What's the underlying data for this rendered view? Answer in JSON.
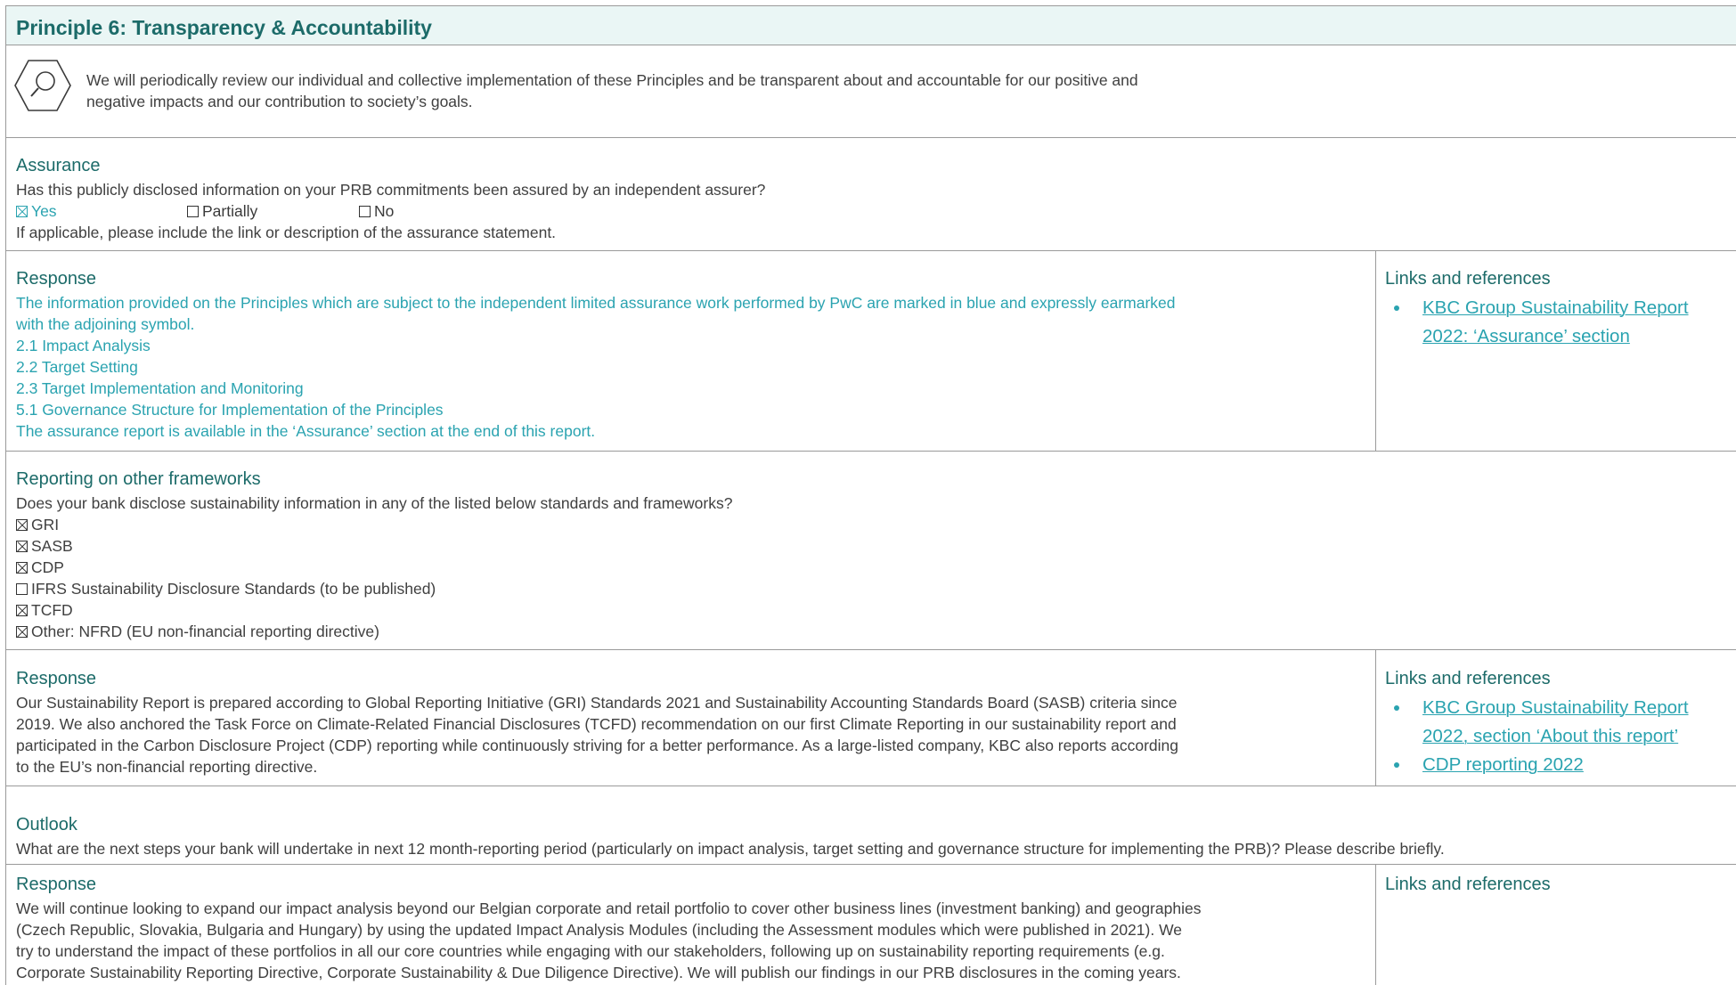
{
  "title": "Principle 6: Transparency & Accountability",
  "intro": {
    "icon": "magnifier-hexagon-icon",
    "lines": [
      "We will periodically review our individual and collective implementation of these Principles and be transparent about and accountable for our positive and",
      "negative impacts and our contribution to society’s goals."
    ]
  },
  "assurance": {
    "heading": "Assurance",
    "question": "Has this publicly disclosed information on your PRB commitments been assured by an independent assurer?",
    "options": [
      {
        "label": "Yes",
        "checked": true
      },
      {
        "label": "Partially",
        "checked": false
      },
      {
        "label": "No",
        "checked": false
      }
    ],
    "note": "If applicable, please include the link or description of the assurance statement."
  },
  "response1": {
    "heading": "Response",
    "lines": [
      "The information provided on the Principles which are subject to the independent limited assurance work performed by PwC are marked in blue and expressly earmarked",
      "with the adjoining symbol.",
      "2.1 Impact Analysis",
      "2.2 Target Setting",
      "2.3 Target Implementation and Monitoring",
      "5.1 Governance Structure for Implementation of the Principles",
      "The assurance report is available in the ‘Assurance’ section at the end of this report."
    ],
    "links_heading": "Links and references",
    "links": [
      {
        "lines": [
          "KBC Group Sustainability Report",
          "2022: ‘Assurance’ section"
        ]
      }
    ]
  },
  "frameworks": {
    "heading": "Reporting on other frameworks",
    "question": "Does your bank disclose sustainability information in any of the listed below standards and frameworks?",
    "items": [
      {
        "label": "GRI",
        "checked": true
      },
      {
        "label": "SASB",
        "checked": true
      },
      {
        "label": "CDP",
        "checked": true
      },
      {
        "label": "IFRS Sustainability Disclosure Standards (to be published)",
        "checked": false
      },
      {
        "label": "TCFD",
        "checked": true
      },
      {
        "label": "Other: NFRD (EU non-financial reporting directive)",
        "checked": true
      }
    ]
  },
  "response2": {
    "heading": "Response",
    "lines": [
      "Our Sustainability Report is prepared according to Global Reporting Initiative (GRI) Standards 2021 and Sustainability Accounting Standards Board (SASB) criteria since",
      "2019. We also anchored the Task Force on Climate-Related Financial Disclosures (TCFD) recommendation on our first Climate Reporting in our sustainability report and",
      "participated in the Carbon Disclosure Project (CDP) reporting while continuously striving for a better performance. As a large-listed company, KBC also reports according",
      "to the EU’s non-financial reporting directive."
    ],
    "links_heading": "Links and references",
    "links": [
      {
        "lines": [
          "KBC Group Sustainability Report",
          "2022, section ‘About this report’"
        ]
      },
      {
        "lines": [
          "CDP reporting 2022"
        ]
      }
    ]
  },
  "outlook": {
    "heading": "Outlook",
    "question": "What are the next steps your bank will undertake in next 12 month-reporting period (particularly on impact analysis, target setting and governance structure for implementing the PRB)? Please describe briefly."
  },
  "response3": {
    "heading": "Response",
    "lines": [
      "We will continue looking to expand our impact analysis beyond our Belgian corporate and retail portfolio to cover other business lines (investment banking) and geographies",
      "(Czech Republic, Slovakia, Bulgaria and Hungary) by using the updated Impact Analysis Modules (including the Assessment modules which were published in 2021). We",
      "try to understand the impact of these portfolios in all our core countries while engaging with our stakeholders, following up on sustainability reporting requirements (e.g.",
      "Corporate Sustainability Reporting Directive, Corporate Sustainability & Due Diligence Directive). We will publish our findings in our PRB disclosures in the coming years."
    ],
    "links_heading": "Links and references"
  },
  "colors": {
    "accent": "#1c6b69",
    "assured_text": "#2aa3b0",
    "title_bg": "#eaf6f5"
  }
}
